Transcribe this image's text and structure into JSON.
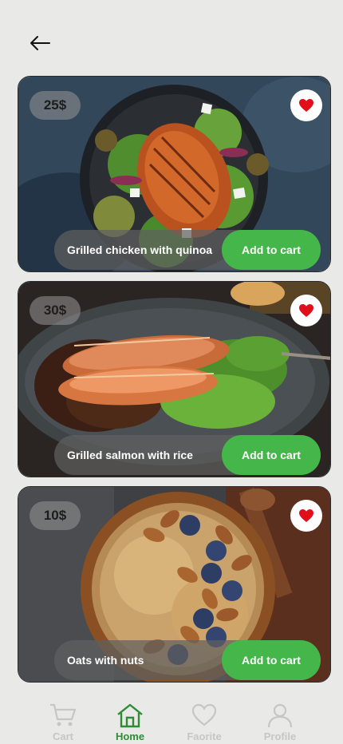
{
  "header": {
    "back_icon": "arrow-left-icon"
  },
  "products": [
    {
      "price": "25$",
      "name": "Grilled chicken with quinoa",
      "add_label": "Add to cart",
      "favorite": true
    },
    {
      "price": "30$",
      "name": "Grilled salmon with rice",
      "add_label": "Add to cart",
      "favorite": true
    },
    {
      "price": "10$",
      "name": "Oats with nuts",
      "add_label": "Add to cart",
      "favorite": true
    }
  ],
  "nav": {
    "items": [
      {
        "label": "Cart",
        "icon": "cart-icon",
        "active": false
      },
      {
        "label": "Home",
        "icon": "home-icon",
        "active": true
      },
      {
        "label": "Faorite",
        "icon": "heart-icon",
        "active": false
      },
      {
        "label": "Profile",
        "icon": "profile-icon",
        "active": false
      }
    ]
  },
  "colors": {
    "background": "#e9e9e7",
    "accent_green": "#45b649",
    "nav_active": "#2f8c35",
    "nav_inactive": "#c6c6c6",
    "heart_red": "#e0101b"
  }
}
